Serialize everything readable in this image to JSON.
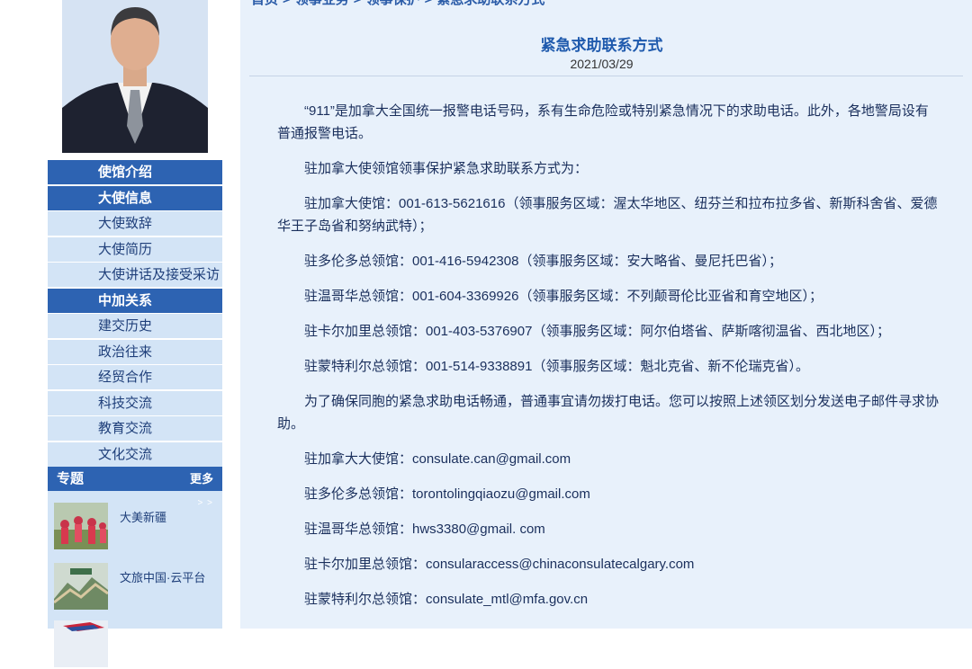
{
  "breadcrumb": [
    "首页",
    "领事业务",
    "领事保护",
    "紧急求助联系方式"
  ],
  "sidebar": {
    "nav": [
      {
        "label": "使馆介绍",
        "kind": "head"
      },
      {
        "label": "大使信息",
        "kind": "head"
      },
      {
        "label": "大使致辞",
        "kind": "sub"
      },
      {
        "label": "大使简历",
        "kind": "sub"
      },
      {
        "label": "大使讲话及接受采访",
        "kind": "sub"
      },
      {
        "label": "中加关系",
        "kind": "head"
      },
      {
        "label": "建交历史",
        "kind": "sub"
      },
      {
        "label": "政治往来",
        "kind": "sub"
      },
      {
        "label": "经贸合作",
        "kind": "sub"
      },
      {
        "label": "科技交流",
        "kind": "sub"
      },
      {
        "label": "教育交流",
        "kind": "sub"
      },
      {
        "label": "文化交流",
        "kind": "sub"
      }
    ],
    "topic_title": "专题",
    "topic_more": "更多",
    "topic_arrows": "> >",
    "topics": [
      {
        "label": "大美新疆",
        "icon": "xinjiang-dancers-image"
      },
      {
        "label": "文旅中国·云平台",
        "icon": "great-wall-image"
      },
      {
        "label": "",
        "icon": "flag-image"
      }
    ]
  },
  "article": {
    "title": "紧急求助联系方式",
    "date": "2021/03/29",
    "paragraphs": [
      "“911”是加拿大全国统一报警电话号码，系有生命危险或特别紧急情况下的求助电话。此外，各地警局设有普通报警电话。",
      "驻加拿大使领馆领事保护紧急求助联系方式为：",
      "驻加拿大使馆：001-613-5621616（领事服务区域：渥太华地区、纽芬兰和拉布拉多省、新斯科舍省、爱德华王子岛省和努纳武特）；",
      "驻多伦多总领馆：001-416-5942308（领事服务区域：安大略省、曼尼托巴省）；",
      "驻温哥华总领馆：001-604-3369926（领事服务区域：不列颠哥伦比亚省和育空地区）；",
      "驻卡尔加里总领馆：001-403-5376907（领事服务区域：阿尔伯塔省、萨斯喀彻温省、西北地区）；",
      "驻蒙特利尔总领馆：001-514-9338891（领事服务区域：魁北克省、新不伦瑞克省）。",
      "为了确保同胞的紧急求助电话畅通，普通事宜请勿拨打电话。您可以按照上述领区划分发送电子邮件寻求协助。",
      "驻加拿大大使馆：consulate.can@gmail.com",
      "驻多伦多总领馆：torontolingqiaozu@gmail.com",
      "驻温哥华总领馆：hws3380@gmail. com",
      "驻卡尔加里总领馆：consularaccess@chinaconsulatecalgary.com",
      "驻蒙特利尔总领馆：consulate_mtl@mfa.gov.cn"
    ]
  }
}
